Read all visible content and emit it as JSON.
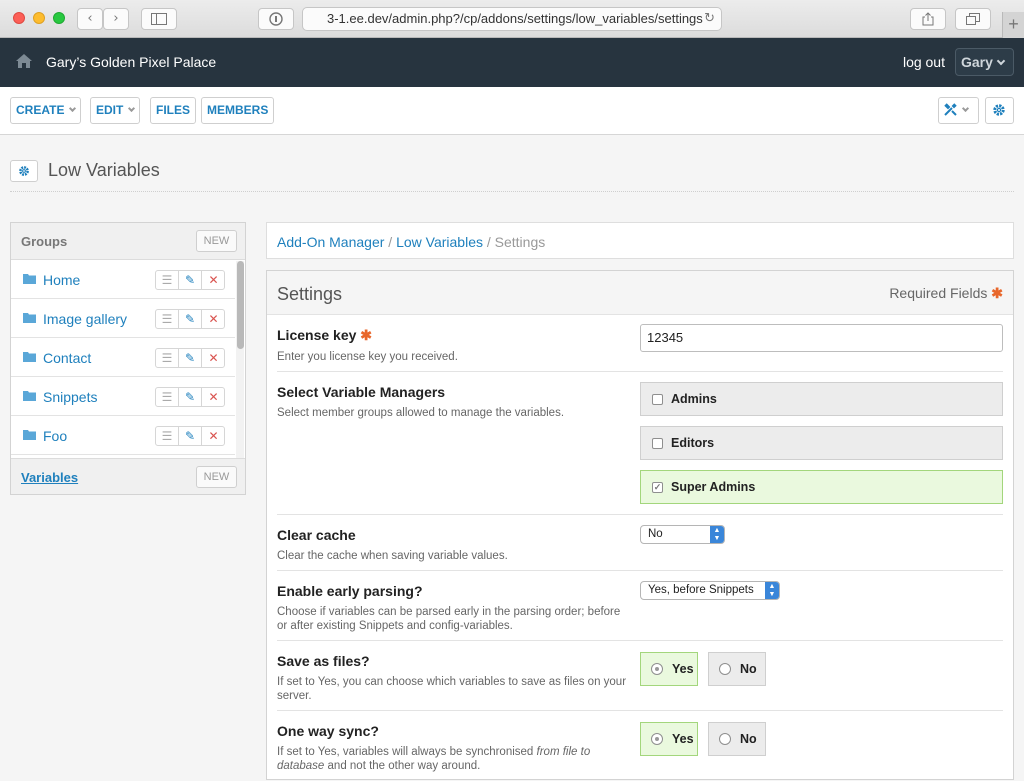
{
  "browser": {
    "url": "3-1.ee.dev/admin.php?/cp/addons/settings/low_variables/settings",
    "back_glyph": "‹",
    "forward_glyph": "›",
    "new_tab_glyph": "+"
  },
  "header": {
    "site_name": "Gary’s Golden Pixel Palace",
    "logout_label": "log out",
    "user_name": "Gary"
  },
  "toolbar": {
    "create_label": "CREATE",
    "edit_label": "EDIT",
    "files_label": "FILES",
    "members_label": "MEMBERS"
  },
  "page": {
    "title": "Low Variables"
  },
  "sidebar": {
    "groups_title": "Groups",
    "new_label": "NEW",
    "items": [
      {
        "label": "Home"
      },
      {
        "label": "Image gallery"
      },
      {
        "label": "Contact"
      },
      {
        "label": "Snippets"
      },
      {
        "label": "Foo"
      }
    ],
    "variables_label": "Variables",
    "variables_new_label": "NEW"
  },
  "breadcrumb": {
    "items": [
      "Add-On Manager",
      "Low Variables"
    ],
    "current": "Settings",
    "separator": "/"
  },
  "settings": {
    "title": "Settings",
    "required_label": "Required Fields",
    "required_mark": "✱",
    "license": {
      "name": "License key",
      "desc": "Enter you license key you received.",
      "value": "12345"
    },
    "managers": {
      "name": "Select Variable Managers",
      "desc": "Select member groups allowed to manage the variables.",
      "options": [
        {
          "label": "Admins",
          "checked": false
        },
        {
          "label": "Editors",
          "checked": false
        },
        {
          "label": "Super Admins",
          "checked": true
        }
      ]
    },
    "clear_cache": {
      "name": "Clear cache",
      "desc": "Clear the cache when saving variable values.",
      "value": "No"
    },
    "early_parsing": {
      "name": "Enable early parsing?",
      "desc": "Choose if variables can be parsed early in the parsing order; before or after existing Snippets and config-variables.",
      "value": "Yes, before Snippets"
    },
    "save_as_files": {
      "name": "Save as files?",
      "desc": "If set to Yes, you can choose which variables to save as files on your server.",
      "yes": "Yes",
      "no": "No",
      "selected": "Yes"
    },
    "one_way_sync": {
      "name": "One way sync?",
      "desc_pre": "If set to Yes, variables will always be synchronised ",
      "desc_em": "from file to database",
      "desc_post": " and not the other way around.",
      "yes": "Yes",
      "no": "No",
      "selected": "Yes"
    }
  },
  "colors": {
    "accent": "#1f80bd",
    "header_bg": "#27343f",
    "required": "#e8662a",
    "selected_bg": "#eaf9de"
  }
}
